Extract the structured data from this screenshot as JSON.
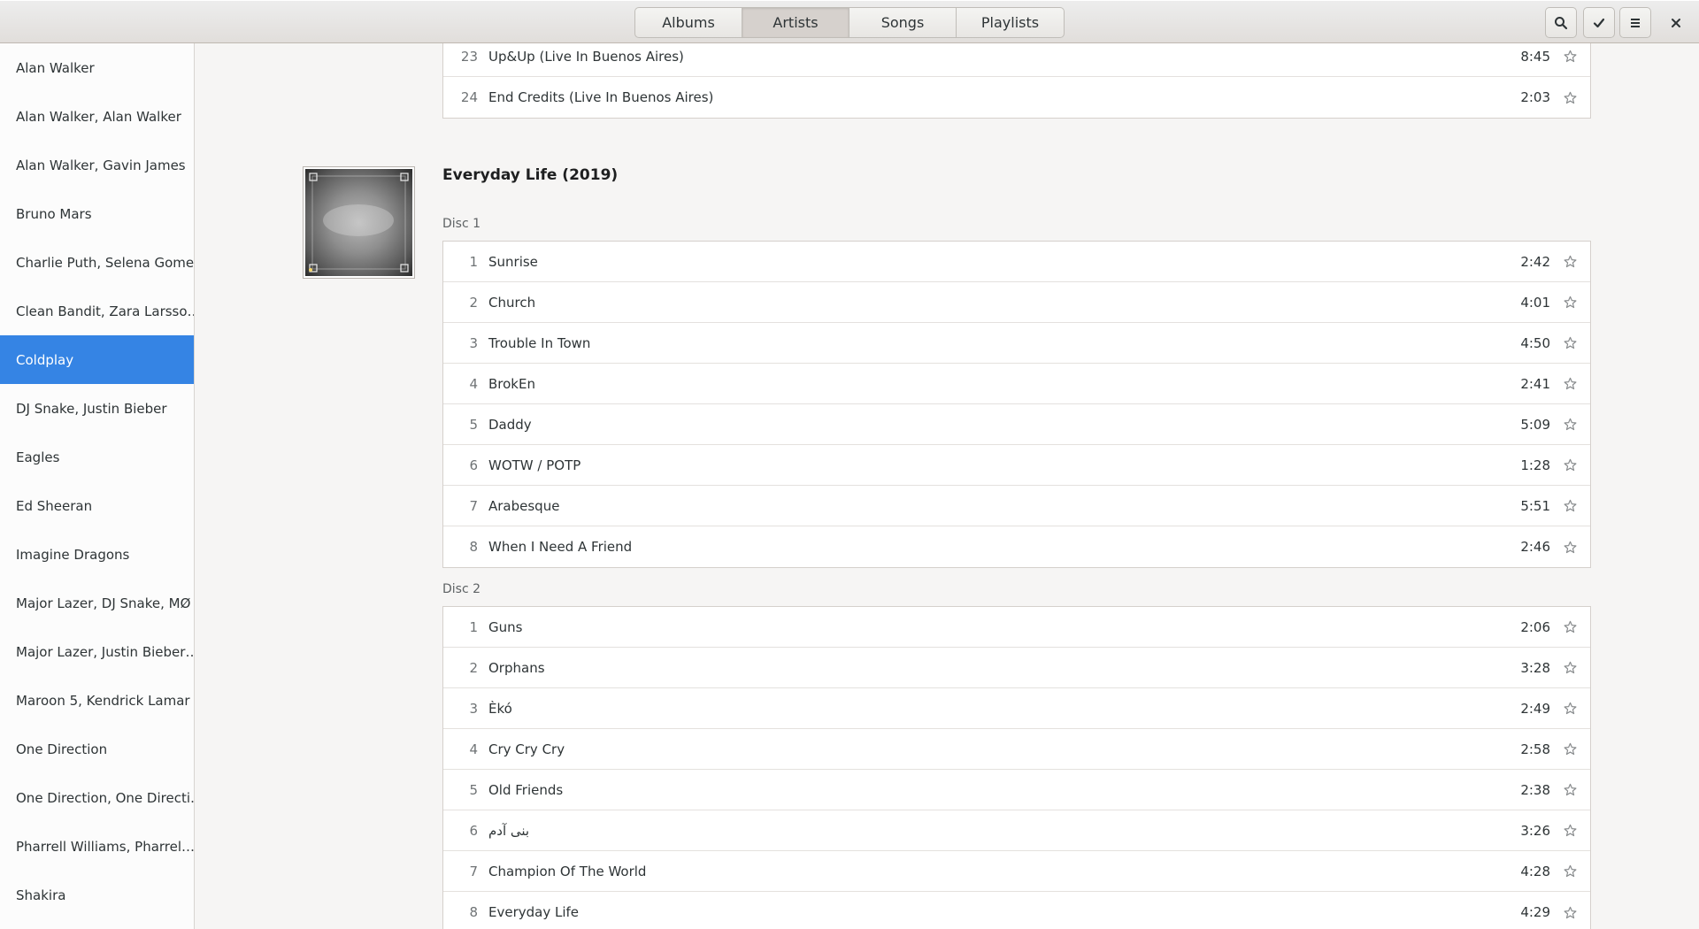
{
  "header": {
    "tabs": [
      {
        "label": "Albums",
        "active": false
      },
      {
        "label": "Artists",
        "active": true
      },
      {
        "label": "Songs",
        "active": false
      },
      {
        "label": "Playlists",
        "active": false
      }
    ],
    "buttons": [
      "search-icon",
      "check-icon",
      "menu-icon"
    ],
    "close_icon": "close-icon"
  },
  "sidebar": {
    "artists": [
      "Alan Walker",
      "Alan Walker, Alan Walker",
      "Alan Walker, Gavin James",
      "Bruno Mars",
      "Charlie Puth, Selena Gomez",
      "Clean Bandit, Zara Larsso…",
      "Coldplay",
      "DJ Snake, Justin Bieber",
      "Eagles",
      "Ed Sheeran",
      "Imagine Dragons",
      "Major Lazer, DJ Snake, MØ",
      "Major Lazer, Justin Bieber…",
      "Maroon 5, Kendrick Lamar",
      "One Direction",
      "One Direction, One Directi…",
      "Pharrell Williams, Pharrel…",
      "Shakira"
    ],
    "selected": "Coldplay"
  },
  "previous_album": {
    "tracks": [
      {
        "num": "23",
        "title": "Up&Up (Live In Buenos Aires)",
        "duration": "8:45"
      },
      {
        "num": "24",
        "title": "End Credits (Live In Buenos Aires)",
        "duration": "2:03"
      }
    ]
  },
  "album": {
    "title": "Everyday Life (2019)",
    "discs": [
      {
        "label": "Disc 1",
        "tracks": [
          {
            "num": "1",
            "title": "Sunrise",
            "duration": "2:42"
          },
          {
            "num": "2",
            "title": "Church",
            "duration": "4:01"
          },
          {
            "num": "3",
            "title": "Trouble In Town",
            "duration": "4:50"
          },
          {
            "num": "4",
            "title": "BrokEn",
            "duration": "2:41"
          },
          {
            "num": "5",
            "title": "Daddy",
            "duration": "5:09"
          },
          {
            "num": "6",
            "title": "WOTW / POTP",
            "duration": "1:28"
          },
          {
            "num": "7",
            "title": "Arabesque",
            "duration": "5:51"
          },
          {
            "num": "8",
            "title": "When I Need A Friend",
            "duration": "2:46"
          }
        ]
      },
      {
        "label": "Disc 2",
        "tracks": [
          {
            "num": "1",
            "title": "Guns",
            "duration": "2:06"
          },
          {
            "num": "2",
            "title": "Orphans",
            "duration": "3:28"
          },
          {
            "num": "3",
            "title": "Èkó",
            "duration": "2:49"
          },
          {
            "num": "4",
            "title": "Cry Cry Cry",
            "duration": "2:58"
          },
          {
            "num": "5",
            "title": "Old Friends",
            "duration": "2:38"
          },
          {
            "num": "6",
            "title": "بنی آدم",
            "duration": "3:26"
          },
          {
            "num": "7",
            "title": "Champion Of The World",
            "duration": "4:28"
          },
          {
            "num": "8",
            "title": "Everyday Life",
            "duration": "4:29"
          }
        ]
      }
    ]
  },
  "colors": {
    "accent": "#3584e4",
    "header_bg": "#e1dedb",
    "window_bg": "#f6f5f4"
  }
}
